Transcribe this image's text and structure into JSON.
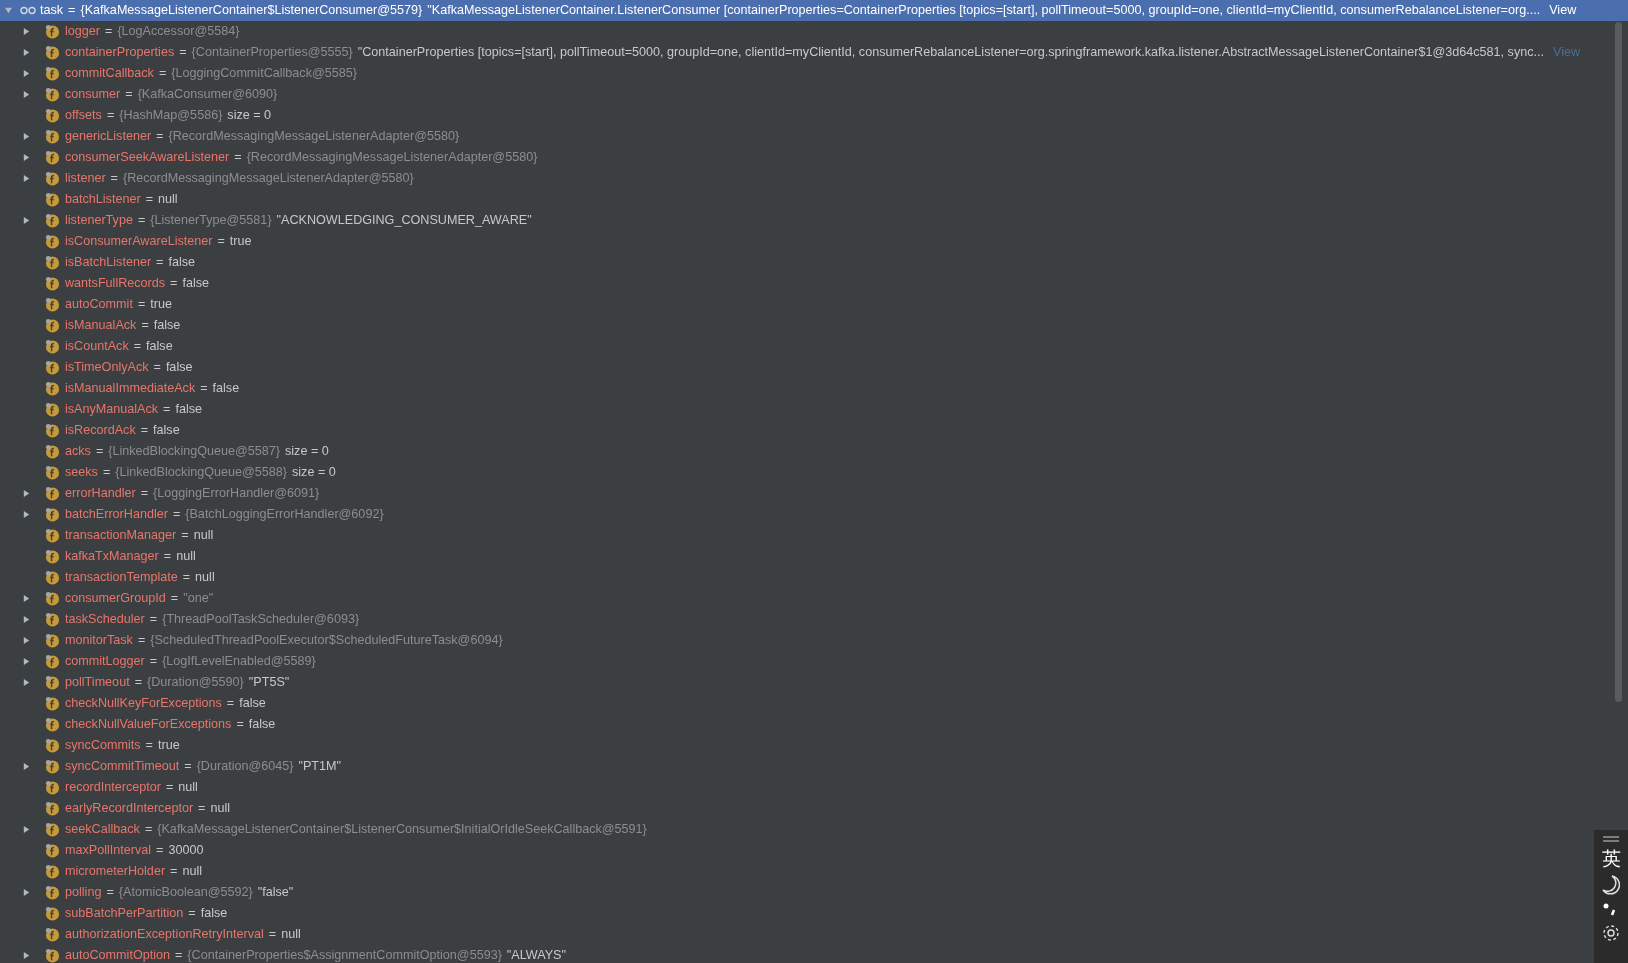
{
  "root": {
    "name": "task",
    "eq": "=",
    "ref": "{KafkaMessageListenerContainer$ListenerConsumer@5579}",
    "value": "\"KafkaMessageListenerContainer.ListenerConsumer [containerProperties=ContainerProperties [topics=[start], pollTimeout=5000, groupId=one, clientId=myClientId, consumerRebalanceListener=org....",
    "link": "View",
    "expanded": true,
    "selected": true
  },
  "children": [
    {
      "name": "logger",
      "eq": "=",
      "ref": "{LogAccessor@5584}",
      "expandable": true
    },
    {
      "name": "containerProperties",
      "eq": "=",
      "ref": "{ContainerProperties@5555}",
      "value": "\"ContainerProperties [topics=[start], pollTimeout=5000, groupId=one, clientId=myClientId, consumerRebalanceListener=org.springframework.kafka.listener.AbstractMessageListenerContainer$1@3d64c581, sync...",
      "link": "View",
      "expandable": true
    },
    {
      "name": "commitCallback",
      "eq": "=",
      "ref": "{LoggingCommitCallback@5585}",
      "expandable": true
    },
    {
      "name": "consumer",
      "eq": "=",
      "ref": "{KafkaConsumer@6090}",
      "expandable": true
    },
    {
      "name": "offsets",
      "eq": "=",
      "ref": "{HashMap@5586}",
      "value": "size = 0",
      "expandable": false
    },
    {
      "name": "genericListener",
      "eq": "=",
      "ref": "{RecordMessagingMessageListenerAdapter@5580}",
      "expandable": true
    },
    {
      "name": "consumerSeekAwareListener",
      "eq": "=",
      "ref": "{RecordMessagingMessageListenerAdapter@5580}",
      "expandable": true
    },
    {
      "name": "listener",
      "eq": "=",
      "ref": "{RecordMessagingMessageListenerAdapter@5580}",
      "expandable": true
    },
    {
      "name": "batchListener",
      "eq": "=",
      "value": "null",
      "expandable": false
    },
    {
      "name": "listenerType",
      "eq": "=",
      "ref": "{ListenerType@5581}",
      "value": "\"ACKNOWLEDGING_CONSUMER_AWARE\"",
      "expandable": true
    },
    {
      "name": "isConsumerAwareListener",
      "eq": "=",
      "value": "true",
      "expandable": false
    },
    {
      "name": "isBatchListener",
      "eq": "=",
      "value": "false",
      "expandable": false
    },
    {
      "name": "wantsFullRecords",
      "eq": "=",
      "value": "false",
      "expandable": false
    },
    {
      "name": "autoCommit",
      "eq": "=",
      "value": "true",
      "expandable": false
    },
    {
      "name": "isManualAck",
      "eq": "=",
      "value": "false",
      "expandable": false
    },
    {
      "name": "isCountAck",
      "eq": "=",
      "value": "false",
      "expandable": false
    },
    {
      "name": "isTimeOnlyAck",
      "eq": "=",
      "value": "false",
      "expandable": false
    },
    {
      "name": "isManualImmediateAck",
      "eq": "=",
      "value": "false",
      "expandable": false
    },
    {
      "name": "isAnyManualAck",
      "eq": "=",
      "value": "false",
      "expandable": false
    },
    {
      "name": "isRecordAck",
      "eq": "=",
      "value": "false",
      "expandable": false
    },
    {
      "name": "acks",
      "eq": "=",
      "ref": "{LinkedBlockingQueue@5587}",
      "value": "size = 0",
      "expandable": false
    },
    {
      "name": "seeks",
      "eq": "=",
      "ref": "{LinkedBlockingQueue@5588}",
      "value": "size = 0",
      "expandable": false
    },
    {
      "name": "errorHandler",
      "eq": "=",
      "ref": "{LoggingErrorHandler@6091}",
      "expandable": true
    },
    {
      "name": "batchErrorHandler",
      "eq": "=",
      "ref": "{BatchLoggingErrorHandler@6092}",
      "expandable": true
    },
    {
      "name": "transactionManager",
      "eq": "=",
      "value": "null",
      "expandable": false
    },
    {
      "name": "kafkaTxManager",
      "eq": "=",
      "value": "null",
      "expandable": false
    },
    {
      "name": "transactionTemplate",
      "eq": "=",
      "value": "null",
      "expandable": false
    },
    {
      "name": "consumerGroupId",
      "eq": "=",
      "ref": "\"one\"",
      "expandable": true
    },
    {
      "name": "taskScheduler",
      "eq": "=",
      "ref": "{ThreadPoolTaskScheduler@6093}",
      "expandable": true
    },
    {
      "name": "monitorTask",
      "eq": "=",
      "ref": "{ScheduledThreadPoolExecutor$ScheduledFutureTask@6094}",
      "expandable": true
    },
    {
      "name": "commitLogger",
      "eq": "=",
      "ref": "{LogIfLevelEnabled@5589}",
      "expandable": true
    },
    {
      "name": "pollTimeout",
      "eq": "=",
      "ref": "{Duration@5590}",
      "value": "\"PT5S\"",
      "expandable": true
    },
    {
      "name": "checkNullKeyForExceptions",
      "eq": "=",
      "value": "false",
      "expandable": false
    },
    {
      "name": "checkNullValueForExceptions",
      "eq": "=",
      "value": "false",
      "expandable": false
    },
    {
      "name": "syncCommits",
      "eq": "=",
      "value": "true",
      "expandable": false
    },
    {
      "name": "syncCommitTimeout",
      "eq": "=",
      "ref": "{Duration@6045}",
      "value": "\"PT1M\"",
      "expandable": true
    },
    {
      "name": "recordInterceptor",
      "eq": "=",
      "value": "null",
      "expandable": false
    },
    {
      "name": "earlyRecordInterceptor",
      "eq": "=",
      "value": "null",
      "expandable": false
    },
    {
      "name": "seekCallback",
      "eq": "=",
      "ref": "{KafkaMessageListenerContainer$ListenerConsumer$InitialOrIdleSeekCallback@5591}",
      "expandable": true
    },
    {
      "name": "maxPollInterval",
      "eq": "=",
      "value": "30000",
      "expandable": false
    },
    {
      "name": "micrometerHolder",
      "eq": "=",
      "value": "null",
      "expandable": false
    },
    {
      "name": "polling",
      "eq": "=",
      "ref": "{AtomicBoolean@5592}",
      "value": "\"false\"",
      "expandable": true
    },
    {
      "name": "subBatchPerPartition",
      "eq": "=",
      "value": "false",
      "expandable": false
    },
    {
      "name": "authorizationExceptionRetryInterval",
      "eq": "=",
      "value": "null",
      "expandable": false
    },
    {
      "name": "autoCommitOption",
      "eq": "=",
      "ref": "{ContainerProperties$AssignmentCommitOption@5593}",
      "value": "\"ALWAYS\"",
      "expandable": true
    }
  ],
  "ime_toolbar": {
    "language": "英"
  }
}
